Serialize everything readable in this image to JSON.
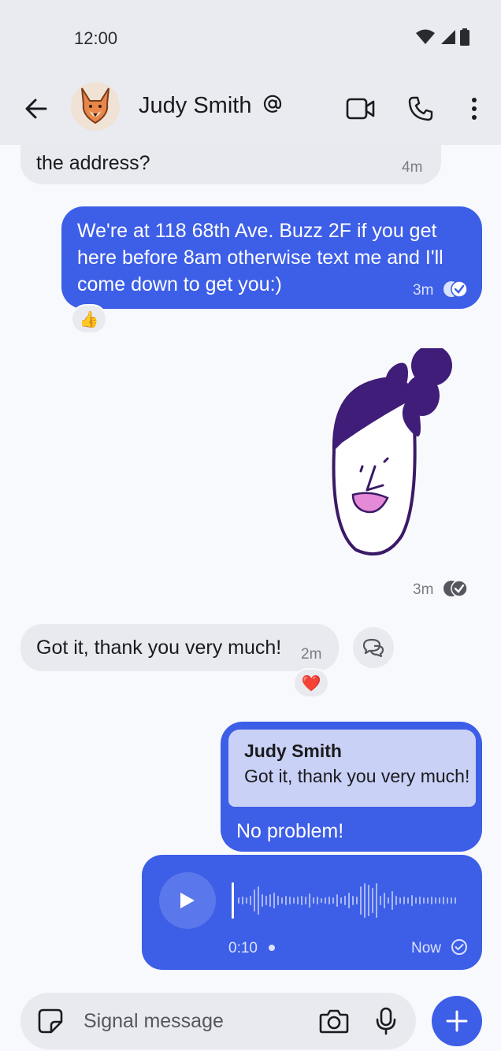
{
  "status_bar": {
    "time": "12:00"
  },
  "header": {
    "contact_name": "Judy Smith"
  },
  "messages": {
    "m1": {
      "text": "the address?",
      "time": "4m"
    },
    "m2": {
      "text": "We're at 118 68th Ave. Buzz 2F if you get here before 8am otherwise text me and I'll come down to get you:)",
      "time": "3m",
      "reaction": "👍"
    },
    "m3": {
      "time": "3m"
    },
    "m4": {
      "text": "Got it, thank you very much!",
      "time": "2m",
      "reaction": "❤️"
    },
    "m5": {
      "quote_author": "Judy Smith",
      "quote_text": "Got it, thank you very much!",
      "text": "No problem!"
    },
    "m6": {
      "duration": "0:10",
      "time": "Now",
      "progress": 0
    }
  },
  "composer": {
    "placeholder": "Signal message"
  },
  "colors": {
    "accent": "#3d5ee6",
    "incoming_bubble": "#e8eaef",
    "header_bg": "#e9ebf1"
  },
  "icons": [
    "back-arrow-icon",
    "at-icon",
    "video-camera-icon",
    "phone-icon",
    "more-vert-icon",
    "double-check-icon",
    "reply-icon",
    "play-icon",
    "sticker-icon",
    "camera-icon",
    "microphone-icon",
    "plus-icon"
  ]
}
